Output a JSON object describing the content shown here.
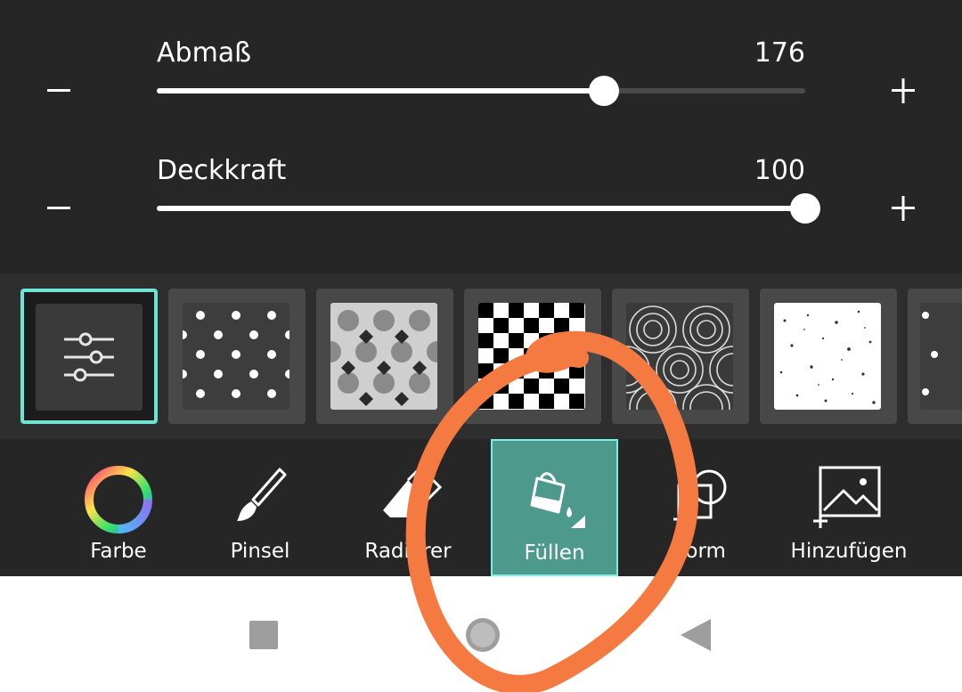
{
  "sliders": [
    {
      "label": "Abmaß",
      "value_text": "176",
      "fraction": 0.689
    },
    {
      "label": "Deckkraft",
      "value_text": "100",
      "fraction": 1.0
    }
  ],
  "controls": {
    "decrease_icon": "minus-icon",
    "increase_icon": "plus-icon"
  },
  "patterns": [
    {
      "name": "adjust",
      "icon": "sliders-icon",
      "selected": true
    },
    {
      "name": "dots"
    },
    {
      "name": "texture"
    },
    {
      "name": "checker"
    },
    {
      "name": "circles"
    },
    {
      "name": "speckle"
    },
    {
      "name": "partial"
    }
  ],
  "tools": [
    {
      "label": "Farbe",
      "icon": "color-wheel-icon"
    },
    {
      "label": "Pinsel",
      "icon": "brush-icon"
    },
    {
      "label": "Radierer",
      "icon": "eraser-icon"
    },
    {
      "label": "Füllen",
      "icon": "fill-bucket-icon",
      "active": true
    },
    {
      "label": "Form",
      "icon": "shape-icon"
    },
    {
      "label": "Hinzufügen",
      "icon": "add-image-icon"
    }
  ],
  "colors": {
    "panel": "#262626",
    "accent": "#4d9a8d",
    "accent_border": "#7cf0df",
    "annotation": "#f57a42"
  },
  "navbar": {
    "icons": [
      "recent-apps-icon",
      "home-icon",
      "back-icon"
    ]
  }
}
